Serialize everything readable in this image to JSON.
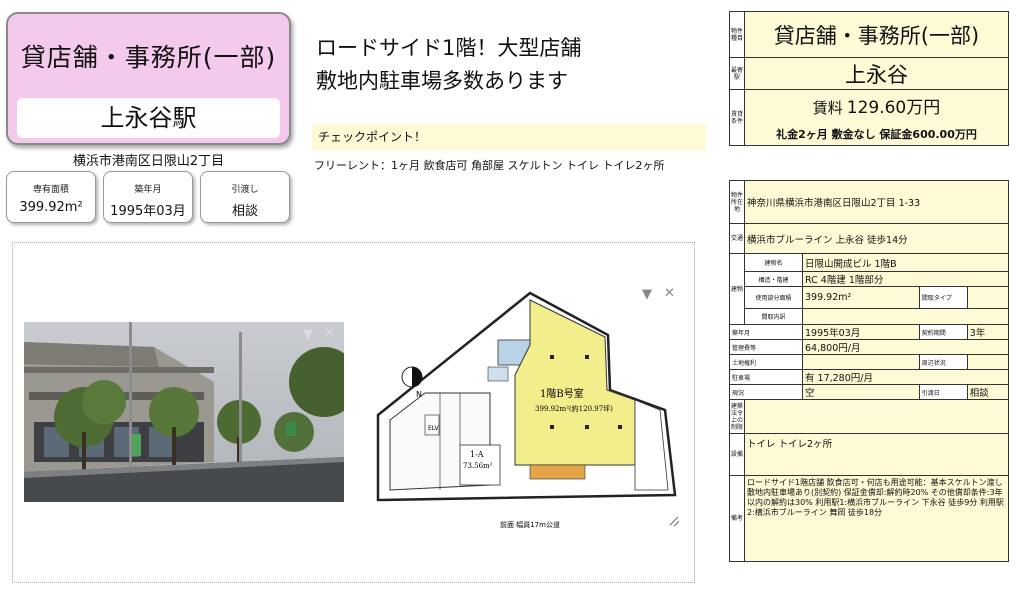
{
  "header": {
    "property_type": "貸店舗・事務所(一部)",
    "station": "上永谷駅",
    "address": "横浜市港南区日限山2丁目"
  },
  "summary_cards": [
    {
      "label": "専有面積",
      "value": "399.92m²"
    },
    {
      "label": "築年月",
      "value": "1995年03月"
    },
    {
      "label": "引渡し",
      "value": "相談"
    }
  ],
  "headline": {
    "line1": "ロードサイド1階！大型店舗",
    "line2": "敷地内駐車場多数あります",
    "checkpoint": "チェックポイント！",
    "features": "フリーレント：1ヶ月 飲食店可 角部屋 スケルトン トイレ トイレ2ヶ所"
  },
  "media": {
    "floorplan": {
      "room_label": "1階B号室",
      "room_area": "399.92m²(約120.97坪)",
      "sub_label": "1-A",
      "sub_area": "73.56m²",
      "elv": "ELV",
      "road": "前面 幅員17m公道",
      "north": "N"
    },
    "controls": {
      "up": "▼",
      "close": "✕"
    }
  },
  "top_table": {
    "side1": "物件種目",
    "side2": "最寄駅",
    "side3": "賃貸条件",
    "property_type": "貸店舗・事務所(一部)",
    "station": "上永谷",
    "rent_label": "賃料",
    "rent_value": "129.60万円",
    "fees": "礼金2ヶ月 敷金なし 保証金600.00万円"
  },
  "detail": {
    "side_location": "物件所在地",
    "location": "神奈川県横浜市港南区日限山2丁目 1-33",
    "side_traffic": "交通",
    "traffic": "横浜市ブルーライン 上永谷 徒歩14分",
    "side_building": "建物",
    "building_name_label": "建物名",
    "building_name": "日限山開成ビル 1階B",
    "structure_label": "構造・階建",
    "structure": "RC 4階建 1階部分",
    "area_label": "使用部分面積",
    "area": "399.92m²",
    "room_type_label": "間取タイプ",
    "room_layout_label": "間取内訳",
    "built_label": "築年月",
    "built": "1995年03月",
    "contract_label": "契約期間",
    "contract": "3年",
    "mgmt_label": "管理費等",
    "mgmt": "64,800円/月",
    "land_label": "土地権利",
    "neighbor_label": "周辺状況",
    "parking_label": "駐車場",
    "parking": "有 17,280円/月",
    "status_label": "現況",
    "status": "空",
    "handover_label": "引渡日",
    "handover": "相談",
    "caution_label": "建築法令上の制限",
    "equip_label": "設備",
    "equipment": "トイレ トイレ2ヶ所",
    "remarks_label": "備考",
    "remarks": "ロードサイド1階店舗 飲食店可・何店も用途可能：基本スケルトン渡し 敷地内駐車場あり(別契約) 保証金償却:解約時20% その他償却条件:3年以内の解約は30% 利用駅1:横浜市ブルーライン 下永谷 徒歩9分 利用駅2:横浜市ブルーライン 舞岡 徒歩18分"
  },
  "colors": {
    "card_pink": "#f3c9ec",
    "cell_cream": "#fefad6",
    "floor_yellow": "#f2ee8c"
  }
}
